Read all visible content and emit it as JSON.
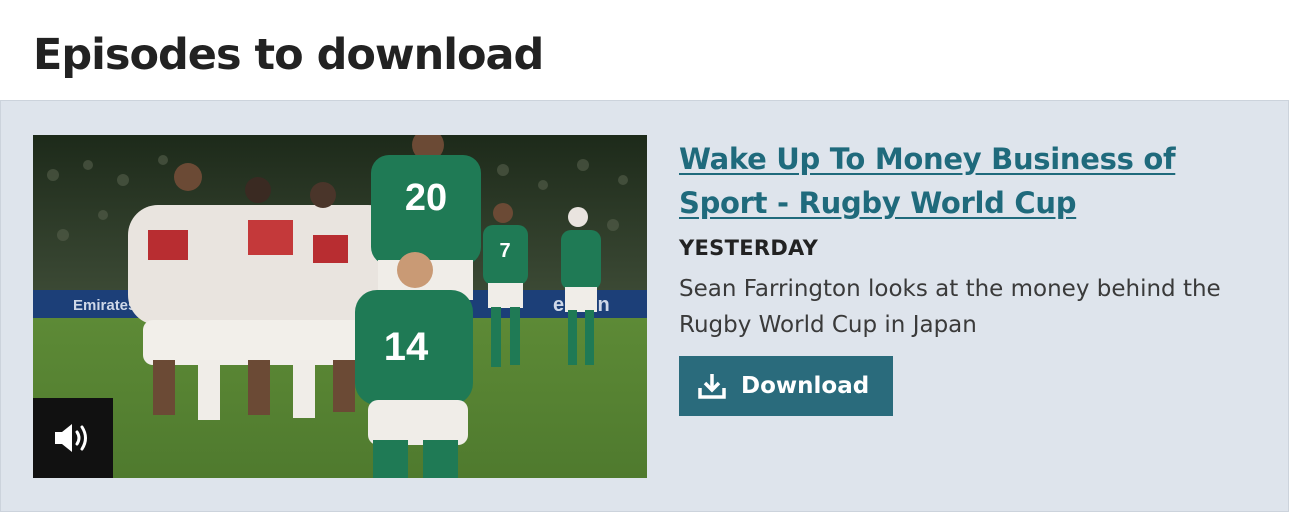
{
  "section": {
    "heading": "Episodes to download"
  },
  "episode": {
    "title": "Wake Up To Money Business of Sport - Rugby World Cup",
    "date": "YESTERDAY",
    "description": "Sean Farrington looks at the money behind the Rugby World Cup in Japan",
    "download_label": "Download",
    "thumbnail": {
      "shirt_numbers": [
        "20",
        "7",
        "14"
      ],
      "board_text": [
        "Emirates",
        "ekeen"
      ]
    },
    "badge_icon": "speaker-icon"
  },
  "colors": {
    "panel_bg": "#dee4ec",
    "link": "#1f6a7c",
    "button_bg": "#2a6b7c",
    "heading": "#222222"
  }
}
